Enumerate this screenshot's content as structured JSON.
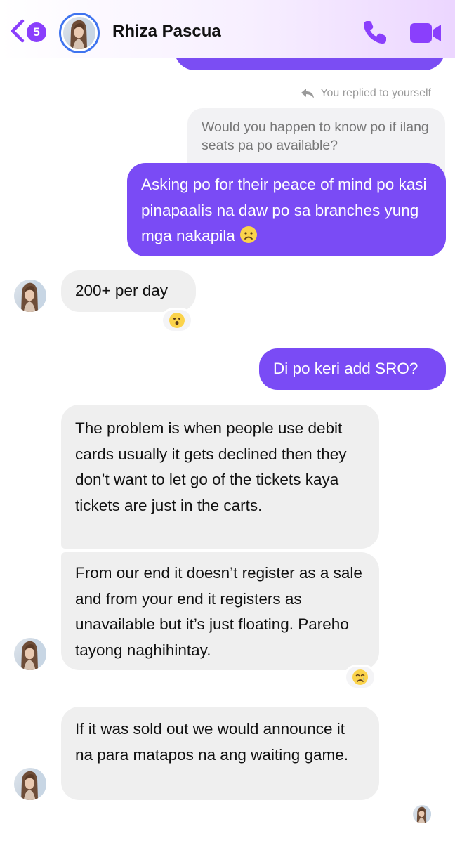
{
  "header": {
    "unread_count": "5",
    "contact_name": "Rhiza Pascua"
  },
  "thread": {
    "reply_note": "You replied to yourself",
    "quoted_message": "Would you happen to know po if ilang seats pa po available?",
    "messages": [
      {
        "sender": "me",
        "text": "Asking po for their peace of mind po kasi pinapaalis na daw po sa branches yung mga nakapila",
        "emoji": "frowning-face"
      },
      {
        "sender": "them",
        "text": "200+ per day",
        "reaction": "hushed-face"
      },
      {
        "sender": "me",
        "text": "Di po keri add SRO?"
      },
      {
        "sender": "them",
        "text": "The problem is when people use debit cards usually it gets declined then they don’t want to let go of the tickets kaya tickets are just in the carts."
      },
      {
        "sender": "them",
        "text": "From our end it doesn’t register as a sale and from your end it registers as unavailable but it’s just floating. Pareho tayong naghihintay.",
        "reaction": "crying-face"
      },
      {
        "sender": "them",
        "text": "If it was sold out we would announce it na para matapos na ang waiting game."
      }
    ]
  },
  "colors": {
    "accent": "#8a3ffc",
    "outgoing_bubble": "#7a4bf5",
    "incoming_bubble": "#efefef",
    "avatar_ring": "#3f74ef"
  },
  "icons": [
    "back-chevron-icon",
    "phone-icon",
    "video-camera-icon",
    "reply-arrow-icon"
  ]
}
